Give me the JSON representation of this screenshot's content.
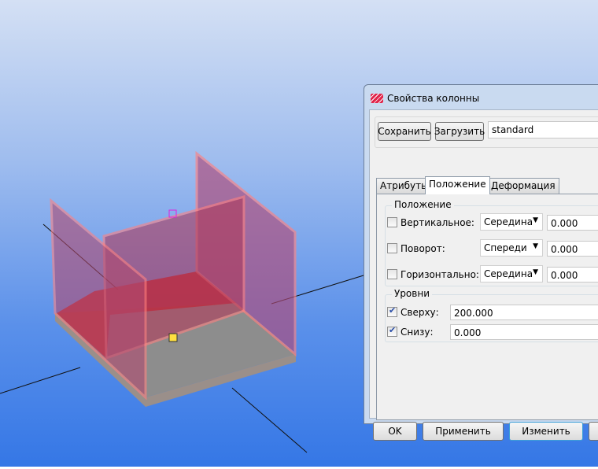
{
  "dialog": {
    "title": "Свойства колонны",
    "toolbar": {
      "save": "Сохранить",
      "load": "Загрузить",
      "preset": "standard"
    },
    "tabs": [
      "Атрибуты",
      "Положение",
      "Деформация"
    ],
    "active_tab": "Положение",
    "position_group": {
      "title": "Положение",
      "rows": [
        {
          "label": "Вертикальное:",
          "checked": false,
          "option": "Середина",
          "value": "0.000"
        },
        {
          "label": "Поворот:",
          "checked": false,
          "option": "Спереди",
          "value": "0.000"
        },
        {
          "label": "Горизонтально:",
          "checked": false,
          "option": "Середина",
          "value": "0.000"
        }
      ]
    },
    "levels_group": {
      "title": "Уровни",
      "rows": [
        {
          "label": "Сверху:",
          "checked": true,
          "value": "200.000"
        },
        {
          "label": "Снизу:",
          "checked": true,
          "value": "0.000"
        }
      ]
    },
    "buttons": {
      "ok": "OK",
      "apply": "Применить",
      "modify": "Изменить"
    }
  }
}
